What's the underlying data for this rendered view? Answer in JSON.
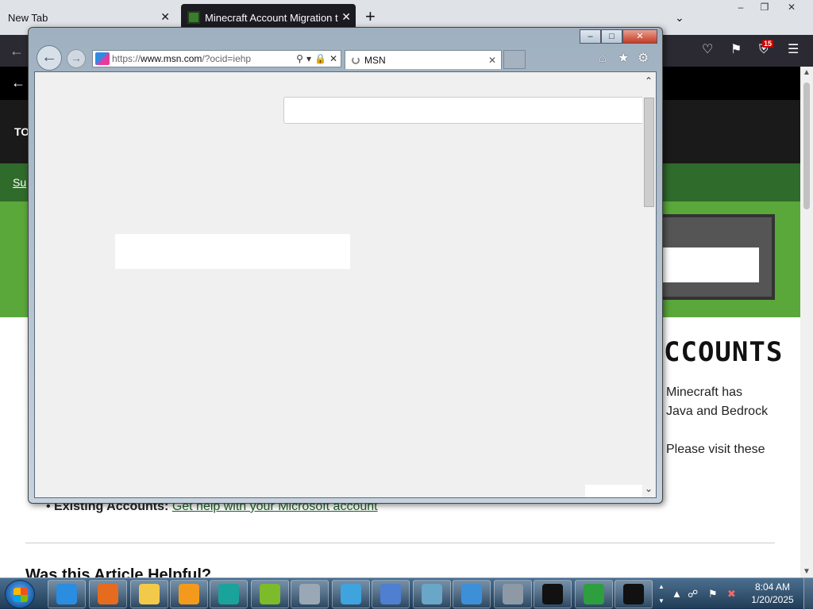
{
  "firefox": {
    "tabs": [
      {
        "label": "New Tab"
      },
      {
        "label": "Minecraft Account Migration to"
      }
    ],
    "close_glyph": "✕",
    "new_tab_glyph": "+",
    "list_all_glyph": "⌄",
    "badge_count": "15"
  },
  "page": {
    "nav_label": "TO",
    "sub_link": "Su",
    "heading": "CCOUNTS",
    "para1": "Minecraft has",
    "para2": "Java and Bedrock",
    "para3": "Please visit these",
    "bullet_bold": "Existing Accounts:",
    "bullet_link": "Get help with your Microsoft account",
    "helpful": "Was this Article Helpful?"
  },
  "ie": {
    "url_prefix": "https://",
    "url_host": "www.msn.com",
    "url_path": "/?ocid=iehp",
    "tab_title": "MSN",
    "tab_close": "✕"
  },
  "taskbar": {
    "time": "8:04 AM",
    "date": "1/20/2025",
    "pinned": [
      {
        "name": "internet-explorer",
        "color": "#2a8de0"
      },
      {
        "name": "firefox",
        "color": "#e56b1f"
      },
      {
        "name": "file-explorer",
        "color": "#f3c94a"
      },
      {
        "name": "media-player",
        "color": "#f39a1d"
      },
      {
        "name": "app-globe",
        "color": "#1aa39a"
      },
      {
        "name": "app-green-leaf",
        "color": "#7dbb2a"
      },
      {
        "name": "app-document",
        "color": "#9aa8b5"
      },
      {
        "name": "app-telegram",
        "color": "#3fa3dd"
      },
      {
        "name": "app-network",
        "color": "#4e7fd0"
      },
      {
        "name": "app-files",
        "color": "#6aa6c8"
      },
      {
        "name": "app-control-panel",
        "color": "#3d8fd8"
      },
      {
        "name": "calculator",
        "color": "#8d9aa6"
      },
      {
        "name": "command-prompt",
        "color": "#111111"
      },
      {
        "name": "windows-update",
        "color": "#2e9e3f"
      },
      {
        "name": "7zip",
        "color": "#111111"
      }
    ]
  }
}
